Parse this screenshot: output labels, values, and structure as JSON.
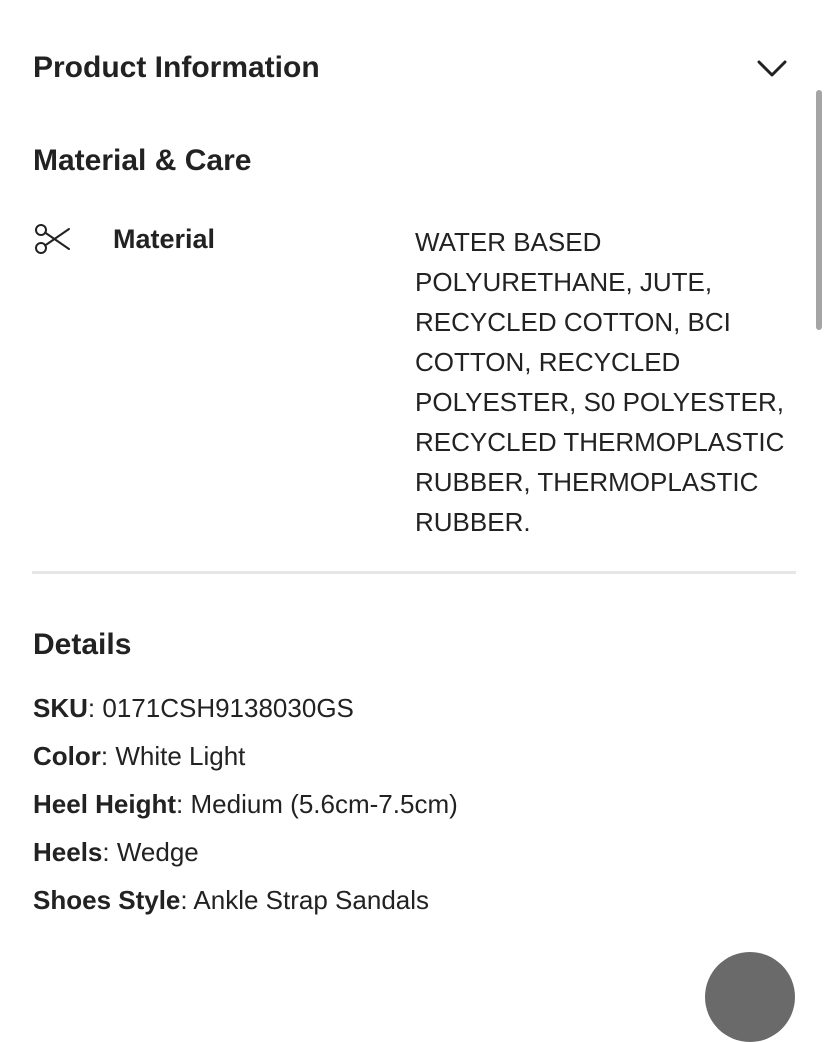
{
  "product_info": {
    "title": "Product Information"
  },
  "material_care": {
    "title": "Material & Care",
    "material_label": "Material",
    "material_value": "WATER BASED POLYURETHANE, JUTE, RECYCLED COTTON, BCI COTTON, RECYCLED POLYESTER, S0 POLYESTER, RECYCLED THERMOPLASTIC RUBBER, THERMOPLASTIC RUBBER."
  },
  "details": {
    "title": "Details",
    "rows": [
      {
        "key": "SKU",
        "value": "0171CSH9138030GS"
      },
      {
        "key": "Color",
        "value": "White Light"
      },
      {
        "key": "Heel Height",
        "value": "Medium (5.6cm-7.5cm)"
      },
      {
        "key": "Heels",
        "value": "Wedge"
      },
      {
        "key": "Shoes Style",
        "value": "Ankle Strap Sandals"
      }
    ]
  },
  "icons": {
    "expand": "chevron-down-icon",
    "material": "scissors-icon"
  }
}
